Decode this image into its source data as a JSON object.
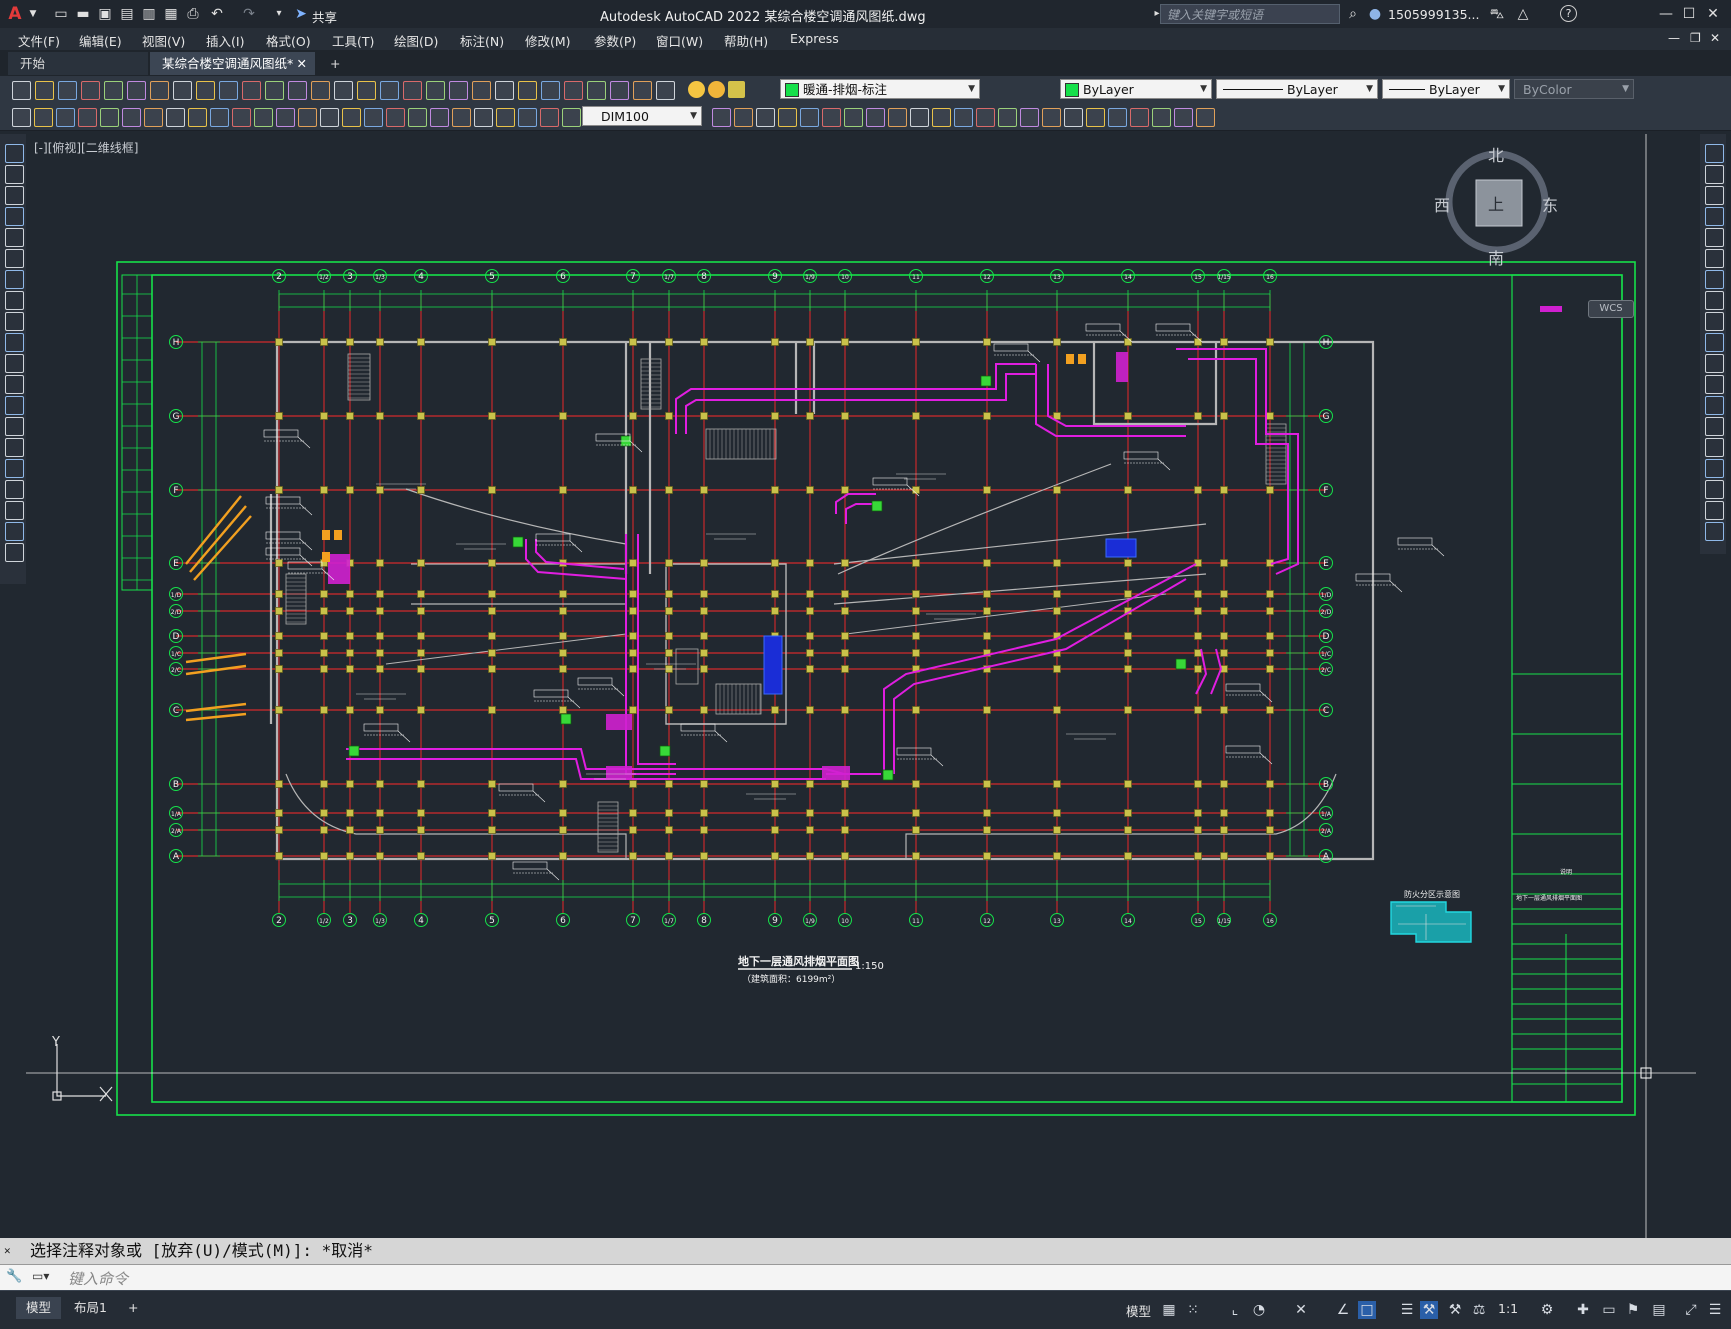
{
  "titlebar": {
    "app_logo": "A",
    "title": "Autodesk AutoCAD 2022    某综合楼空调通风图纸.dwg",
    "share_label": "共享",
    "search_placeholder": "键入关键字或短语",
    "user": "1505999135...",
    "help_icon": "?"
  },
  "menu": [
    "文件(F)",
    "编辑(E)",
    "视图(V)",
    "插入(I)",
    "格式(O)",
    "工具(T)",
    "绘图(D)",
    "标注(N)",
    "修改(M)",
    "参数(P)",
    "窗口(W)",
    "帮助(H)",
    "Express"
  ],
  "tabs": {
    "start": "开始",
    "active": "某综合楼空调通风图纸*",
    "add": "+"
  },
  "toolbar": {
    "layer": "暖通-排烟-标注",
    "color": "ByLayer",
    "linetype": "ByLayer",
    "lineweight": "ByLayer",
    "plotstyle": "ByColor",
    "dimstyle": "DIM100"
  },
  "viewport_label": "[-][俯视][二维线框]",
  "viewcube": {
    "north": "北",
    "south": "南",
    "east": "东",
    "west": "西",
    "top": "上",
    "wcs": "WCS"
  },
  "drawing": {
    "title": "地下一层通风排烟平面图",
    "scale": "1:150",
    "subtitle": "（建筑面积：6199m²）",
    "inset_title": "防火分区示意图",
    "sheet_name": "地下一层通风排烟平面图",
    "sheet_note": "说明",
    "col_top": [
      "2",
      "1/2",
      "3",
      "1/3",
      "4",
      "5",
      "6",
      "7",
      "1/7",
      "8",
      "9",
      "1/9",
      "10",
      "11",
      "12",
      "13",
      "14",
      "15",
      "1/15",
      "16"
    ],
    "rows": [
      "H",
      "G",
      "F",
      "E",
      "1/D",
      "2/D",
      "D",
      "1/C",
      "2/C",
      "C",
      "B",
      "1/A",
      "2/A",
      "A"
    ]
  },
  "ucs": {
    "x": "X",
    "y": "Y"
  },
  "command": {
    "history": "选择注释对象或 [放弃(U)/模式(M)]: *取消*",
    "placeholder": "键入命令"
  },
  "status": {
    "model": "模型",
    "layout1": "布局1",
    "model_btn": "模型",
    "scale": "1:1"
  }
}
